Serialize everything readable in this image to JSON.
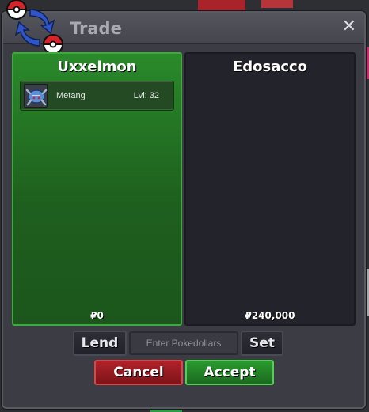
{
  "window": {
    "title": "Trade",
    "close_symbol": "✕"
  },
  "trade_icon": "trade-pokeball-arrows-icon",
  "left_panel": {
    "player_name": "Uxxelmon",
    "items": [
      {
        "icon": "metang-icon",
        "name": "Metang",
        "level": "Lvl: 32"
      }
    ],
    "money": "₽0"
  },
  "right_panel": {
    "player_name": "Edosacco",
    "items": [],
    "money": "₽240,000"
  },
  "controls": {
    "lend_label": "Lend",
    "pokedollar_placeholder": "Enter Pokedollars",
    "pokedollar_value": "",
    "set_label": "Set",
    "cancel_label": "Cancel",
    "accept_label": "Accept"
  },
  "colors": {
    "left_panel_green": "#2a8a2a",
    "right_panel_dark": "#23232b",
    "cancel_red": "#b0222a",
    "accept_green": "#2a9a30"
  }
}
